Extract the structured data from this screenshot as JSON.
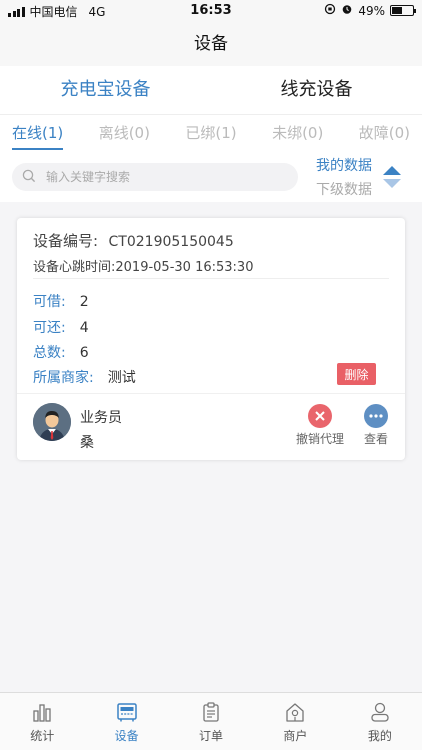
{
  "status_bar": {
    "carrier": "中国电信",
    "network": "4G",
    "time": "16:53",
    "battery": "49%",
    "battery_level": 0.49
  },
  "nav": {
    "title": "设备"
  },
  "device_type_tabs": [
    {
      "label": "充电宝设备",
      "active": true
    },
    {
      "label": "线充设备",
      "active": false
    }
  ],
  "status_tabs": [
    {
      "label": "在线(1)",
      "active": true
    },
    {
      "label": "离线(0)",
      "active": false
    },
    {
      "label": "已绑(1)",
      "active": false
    },
    {
      "label": "未绑(0)",
      "active": false
    },
    {
      "label": "故障(0)",
      "active": false
    }
  ],
  "search": {
    "placeholder": "输入关键字搜索"
  },
  "scope": {
    "mine": "我的数据",
    "sub": "下级数据"
  },
  "device": {
    "id_label": "设备编号:",
    "id_value": "CT021905150045",
    "heartbeat_label": "设备心跳时间:",
    "heartbeat_value": "2019-05-30 16:53:30",
    "borrowable_label": "可借:",
    "borrowable_value": "2",
    "returnable_label": "可还:",
    "returnable_value": "4",
    "total_label": "总数:",
    "total_value": "6",
    "merchant_label": "所属商家:",
    "merchant_value": "测试",
    "delete_label": "删除",
    "agent_role": "业务员",
    "agent_name": "桑",
    "revoke_label": "撤销代理",
    "view_label": "查看"
  },
  "tab_bar": [
    {
      "label": "统计",
      "icon": "bar-chart-icon",
      "active": false
    },
    {
      "label": "设备",
      "icon": "device-icon",
      "active": true
    },
    {
      "label": "订单",
      "icon": "order-clipboard-icon",
      "active": false
    },
    {
      "label": "商户",
      "icon": "merchant-house-icon",
      "active": false
    },
    {
      "label": "我的",
      "icon": "profile-icon",
      "active": false
    }
  ],
  "colors": {
    "accent": "#3b82c4",
    "delete": "#e96066",
    "revoke": "#e9656c",
    "view": "#5e8fc3"
  }
}
